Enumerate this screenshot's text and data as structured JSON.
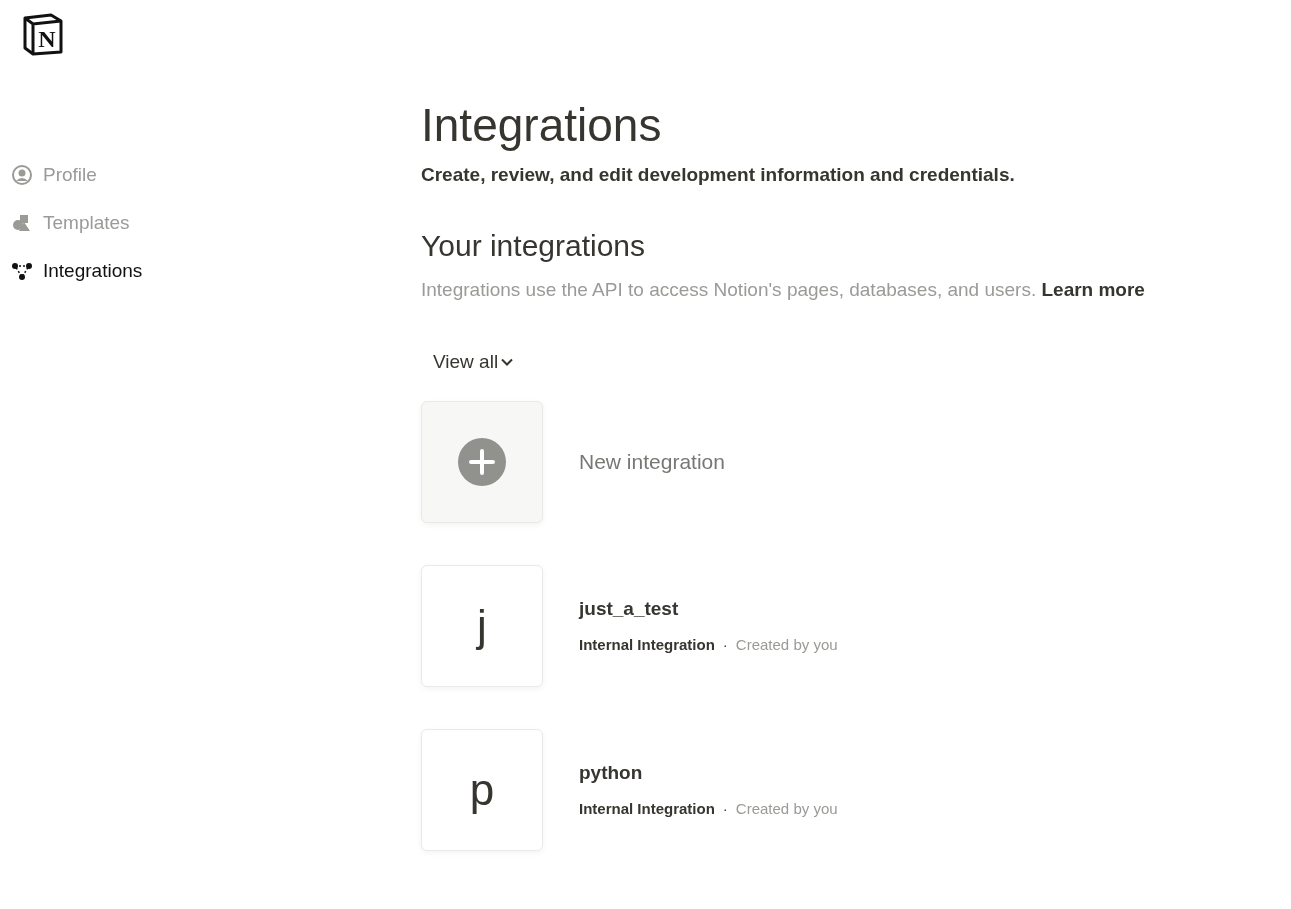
{
  "logo": {
    "letter": "N"
  },
  "sidebar": {
    "items": [
      {
        "label": "Profile",
        "selected": false
      },
      {
        "label": "Templates",
        "selected": false
      },
      {
        "label": "Integrations",
        "selected": true
      }
    ]
  },
  "main": {
    "title": "Integrations",
    "subtitle": "Create, review, and edit development information and credentials.",
    "section_title": "Your integrations",
    "description": "Integrations use the API to access Notion's pages, databases, and users.",
    "learn_more": "Learn more",
    "filter": "View all",
    "items": [
      {
        "kind": "new",
        "label": "New integration"
      },
      {
        "kind": "integration",
        "letter": "j",
        "name": "just_a_test",
        "type": "Internal Integration",
        "separator": "·",
        "creator": "Created by you"
      },
      {
        "kind": "integration",
        "letter": "p",
        "name": "python",
        "type": "Internal Integration",
        "separator": "·",
        "creator": "Created by you"
      }
    ]
  }
}
